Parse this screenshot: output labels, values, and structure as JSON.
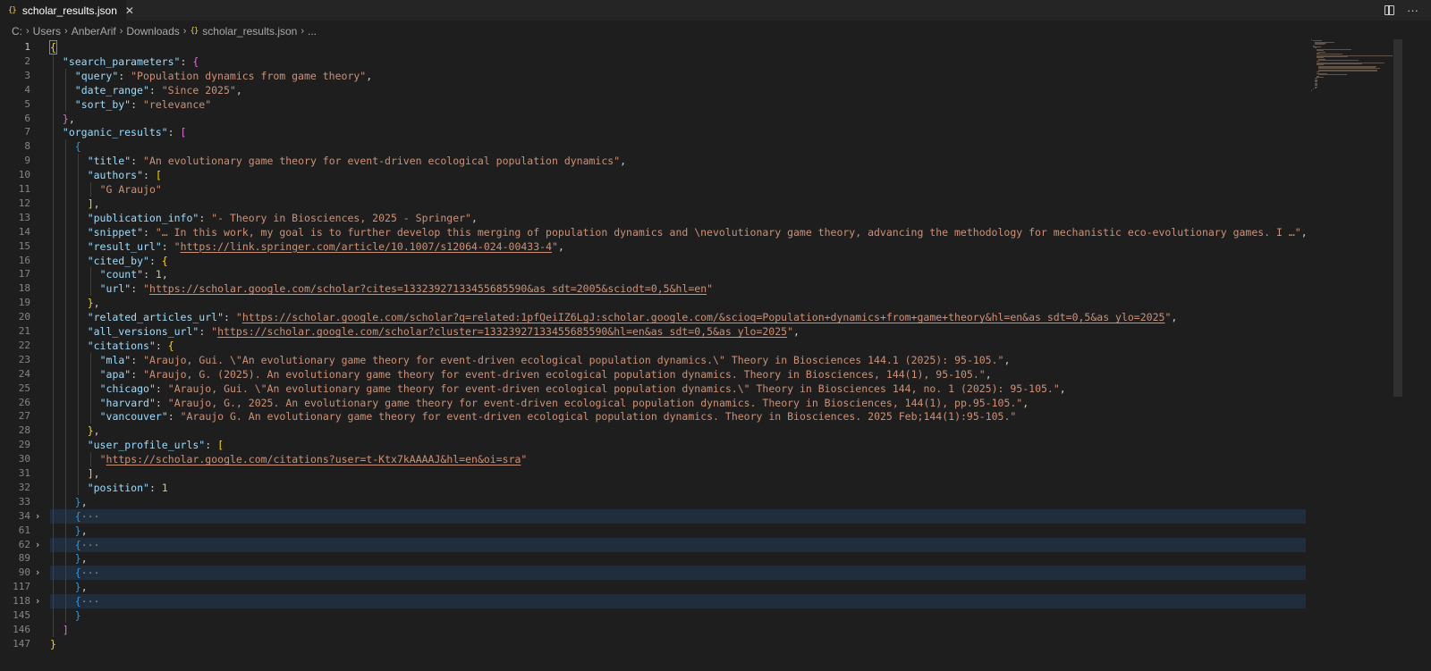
{
  "tab": {
    "icon": "json-braces-icon",
    "icon_text": "{}",
    "name": "scholar_results.json",
    "close": "✕"
  },
  "top_actions": {
    "split": "split-editor-icon",
    "more": "···"
  },
  "breadcrumb": [
    "C:",
    "Users",
    "AnberArif",
    "Downloads",
    "scholar_results.json",
    "..."
  ],
  "breadcrumb_file_icon": "{}",
  "lines": [
    {
      "num": "1",
      "indent": 0,
      "tokens": [
        [
          "b1",
          "{"
        ]
      ],
      "active": true
    },
    {
      "num": "2",
      "indent": 1,
      "tokens": [
        [
          "k",
          "\"search_parameters\""
        ],
        [
          "p",
          ": "
        ],
        [
          "b2",
          "{"
        ]
      ]
    },
    {
      "num": "3",
      "indent": 2,
      "tokens": [
        [
          "k",
          "\"query\""
        ],
        [
          "p",
          ": "
        ],
        [
          "s",
          "\"Population dynamics from game theory\""
        ],
        [
          "p",
          ","
        ]
      ]
    },
    {
      "num": "4",
      "indent": 2,
      "tokens": [
        [
          "k",
          "\"date_range\""
        ],
        [
          "p",
          ": "
        ],
        [
          "s",
          "\"Since 2025\""
        ],
        [
          "p",
          ","
        ]
      ]
    },
    {
      "num": "5",
      "indent": 2,
      "tokens": [
        [
          "k",
          "\"sort_by\""
        ],
        [
          "p",
          ": "
        ],
        [
          "s",
          "\"relevance\""
        ]
      ]
    },
    {
      "num": "6",
      "indent": 1,
      "tokens": [
        [
          "b2",
          "}"
        ],
        [
          "p",
          ","
        ]
      ]
    },
    {
      "num": "7",
      "indent": 1,
      "tokens": [
        [
          "k",
          "\"organic_results\""
        ],
        [
          "p",
          ": "
        ],
        [
          "b2",
          "["
        ]
      ]
    },
    {
      "num": "8",
      "indent": 2,
      "tokens": [
        [
          "b3",
          "{"
        ]
      ]
    },
    {
      "num": "9",
      "indent": 3,
      "tokens": [
        [
          "k",
          "\"title\""
        ],
        [
          "p",
          ": "
        ],
        [
          "s",
          "\"An evolutionary game theory for event-driven ecological population dynamics\""
        ],
        [
          "p",
          ","
        ]
      ]
    },
    {
      "num": "10",
      "indent": 3,
      "tokens": [
        [
          "k",
          "\"authors\""
        ],
        [
          "p",
          ": "
        ],
        [
          "b1",
          "["
        ]
      ]
    },
    {
      "num": "11",
      "indent": 4,
      "tokens": [
        [
          "s",
          "\"G Araujo\""
        ]
      ]
    },
    {
      "num": "12",
      "indent": 3,
      "tokens": [
        [
          "b1",
          "]"
        ],
        [
          "p",
          ","
        ]
      ]
    },
    {
      "num": "13",
      "indent": 3,
      "tokens": [
        [
          "k",
          "\"publication_info\""
        ],
        [
          "p",
          ": "
        ],
        [
          "s",
          "\"- Theory in Biosciences, 2025 - Springer\""
        ],
        [
          "p",
          ","
        ]
      ]
    },
    {
      "num": "14",
      "indent": 3,
      "tokens": [
        [
          "k",
          "\"snippet\""
        ],
        [
          "p",
          ": "
        ],
        [
          "s",
          "\"… In this work, my goal is to further develop this merging of population dynamics and \\nevolutionary game theory, advancing the methodology for mechanistic eco-evolutionary games. I …\""
        ],
        [
          "p",
          ","
        ]
      ]
    },
    {
      "num": "15",
      "indent": 3,
      "tokens": [
        [
          "k",
          "\"result_url\""
        ],
        [
          "p",
          ": "
        ],
        [
          "s",
          "\""
        ],
        [
          "u",
          "https://link.springer.com/article/10.1007/s12064-024-00433-4"
        ],
        [
          "s",
          "\""
        ],
        [
          "p",
          ","
        ]
      ]
    },
    {
      "num": "16",
      "indent": 3,
      "tokens": [
        [
          "k",
          "\"cited_by\""
        ],
        [
          "p",
          ": "
        ],
        [
          "b1",
          "{"
        ]
      ]
    },
    {
      "num": "17",
      "indent": 4,
      "tokens": [
        [
          "k",
          "\"count\""
        ],
        [
          "p",
          ": "
        ],
        [
          "n",
          "1"
        ],
        [
          "p",
          ","
        ]
      ]
    },
    {
      "num": "18",
      "indent": 4,
      "tokens": [
        [
          "k",
          "\"url\""
        ],
        [
          "p",
          ": "
        ],
        [
          "s",
          "\""
        ],
        [
          "u",
          "https://scholar.google.com/scholar?cites=13323927133455685590&as_sdt=2005&sciodt=0,5&hl=en"
        ],
        [
          "s",
          "\""
        ]
      ]
    },
    {
      "num": "19",
      "indent": 3,
      "tokens": [
        [
          "b1",
          "}"
        ],
        [
          "p",
          ","
        ]
      ]
    },
    {
      "num": "20",
      "indent": 3,
      "tokens": [
        [
          "k",
          "\"related_articles_url\""
        ],
        [
          "p",
          ": "
        ],
        [
          "s",
          "\""
        ],
        [
          "u",
          "https://scholar.google.com/scholar?q=related:1pfQeiIZ6LgJ:scholar.google.com/&scioq=Population+dynamics+from+game+theory&hl=en&as_sdt=0,5&as_ylo=2025"
        ],
        [
          "s",
          "\""
        ],
        [
          "p",
          ","
        ]
      ]
    },
    {
      "num": "21",
      "indent": 3,
      "tokens": [
        [
          "k",
          "\"all_versions_url\""
        ],
        [
          "p",
          ": "
        ],
        [
          "s",
          "\""
        ],
        [
          "u",
          "https://scholar.google.com/scholar?cluster=13323927133455685590&hl=en&as_sdt=0,5&as_ylo=2025"
        ],
        [
          "s",
          "\""
        ],
        [
          "p",
          ","
        ]
      ]
    },
    {
      "num": "22",
      "indent": 3,
      "tokens": [
        [
          "k",
          "\"citations\""
        ],
        [
          "p",
          ": "
        ],
        [
          "b1",
          "{"
        ]
      ]
    },
    {
      "num": "23",
      "indent": 4,
      "tokens": [
        [
          "k",
          "\"mla\""
        ],
        [
          "p",
          ": "
        ],
        [
          "s",
          "\"Araujo, Gui. \\\"An evolutionary game theory for event-driven ecological population dynamics.\\\" Theory in Biosciences 144.1 (2025): 95-105.\""
        ],
        [
          "p",
          ","
        ]
      ]
    },
    {
      "num": "24",
      "indent": 4,
      "tokens": [
        [
          "k",
          "\"apa\""
        ],
        [
          "p",
          ": "
        ],
        [
          "s",
          "\"Araujo, G. (2025). An evolutionary game theory for event-driven ecological population dynamics. Theory in Biosciences, 144(1), 95-105.\""
        ],
        [
          "p",
          ","
        ]
      ]
    },
    {
      "num": "25",
      "indent": 4,
      "tokens": [
        [
          "k",
          "\"chicago\""
        ],
        [
          "p",
          ": "
        ],
        [
          "s",
          "\"Araujo, Gui. \\\"An evolutionary game theory for event-driven ecological population dynamics.\\\" Theory in Biosciences 144, no. 1 (2025): 95-105.\""
        ],
        [
          "p",
          ","
        ]
      ]
    },
    {
      "num": "26",
      "indent": 4,
      "tokens": [
        [
          "k",
          "\"harvard\""
        ],
        [
          "p",
          ": "
        ],
        [
          "s",
          "\"Araujo, G., 2025. An evolutionary game theory for event-driven ecological population dynamics. Theory in Biosciences, 144(1), pp.95-105.\""
        ],
        [
          "p",
          ","
        ]
      ]
    },
    {
      "num": "27",
      "indent": 4,
      "tokens": [
        [
          "k",
          "\"vancouver\""
        ],
        [
          "p",
          ": "
        ],
        [
          "s",
          "\"Araujo G. An evolutionary game theory for event-driven ecological population dynamics. Theory in Biosciences. 2025 Feb;144(1):95-105.\""
        ]
      ]
    },
    {
      "num": "28",
      "indent": 3,
      "tokens": [
        [
          "b1",
          "}"
        ],
        [
          "p",
          ","
        ]
      ]
    },
    {
      "num": "29",
      "indent": 3,
      "tokens": [
        [
          "k",
          "\"user_profile_urls\""
        ],
        [
          "p",
          ": "
        ],
        [
          "b1",
          "["
        ]
      ]
    },
    {
      "num": "30",
      "indent": 4,
      "tokens": [
        [
          "s",
          "\""
        ],
        [
          "u",
          "https://scholar.google.com/citations?user=t-Ktx7kAAAAJ&hl=en&oi=sra"
        ],
        [
          "s",
          "\""
        ]
      ]
    },
    {
      "num": "31",
      "indent": 3,
      "tokens": [
        [
          "b1",
          "]"
        ],
        [
          "p",
          ","
        ]
      ]
    },
    {
      "num": "32",
      "indent": 3,
      "tokens": [
        [
          "k",
          "\"position\""
        ],
        [
          "p",
          ": "
        ],
        [
          "n",
          "1"
        ]
      ]
    },
    {
      "num": "33",
      "indent": 2,
      "tokens": [
        [
          "b3",
          "}"
        ],
        [
          "p",
          ","
        ]
      ]
    },
    {
      "num": "34",
      "indent": 2,
      "tokens": [
        [
          "b3",
          "{"
        ],
        [
          "ell",
          "···"
        ]
      ],
      "folded": true
    },
    {
      "num": "61",
      "indent": 2,
      "tokens": [
        [
          "b3",
          "}"
        ],
        [
          "p",
          ","
        ]
      ]
    },
    {
      "num": "62",
      "indent": 2,
      "tokens": [
        [
          "b3",
          "{"
        ],
        [
          "ell",
          "···"
        ]
      ],
      "folded": true
    },
    {
      "num": "89",
      "indent": 2,
      "tokens": [
        [
          "b3",
          "}"
        ],
        [
          "p",
          ","
        ]
      ]
    },
    {
      "num": "90",
      "indent": 2,
      "tokens": [
        [
          "b3",
          "{"
        ],
        [
          "ell",
          "···"
        ]
      ],
      "folded": true
    },
    {
      "num": "117",
      "indent": 2,
      "tokens": [
        [
          "b3",
          "}"
        ],
        [
          "p",
          ","
        ]
      ]
    },
    {
      "num": "118",
      "indent": 2,
      "tokens": [
        [
          "b3",
          "{"
        ],
        [
          "ell",
          "···"
        ]
      ],
      "folded": true
    },
    {
      "num": "145",
      "indent": 2,
      "tokens": [
        [
          "b3",
          "}"
        ]
      ]
    },
    {
      "num": "146",
      "indent": 1,
      "tokens": [
        [
          "b2",
          "]"
        ]
      ]
    },
    {
      "num": "147",
      "indent": 0,
      "tokens": [
        [
          "b1",
          "}"
        ]
      ]
    }
  ],
  "fold_glyph": "›"
}
